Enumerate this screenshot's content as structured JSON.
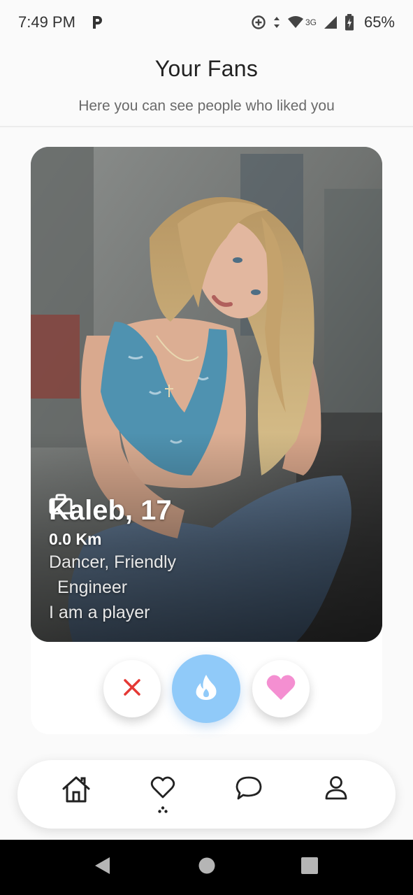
{
  "status_bar": {
    "time": "7:49 PM",
    "p_label": "P",
    "network": "3G",
    "battery": "65%"
  },
  "header": {
    "title": "Your Fans",
    "subtitle": "Here you can see people who liked you"
  },
  "profile": {
    "name_age": "Kaleb, 17",
    "distance": "0.0 Km",
    "tags": "Dancer, Friendly",
    "job": "Engineer",
    "bio": "I am a player"
  },
  "actions": {
    "dislike_icon": "close-icon",
    "superlike_icon": "flame-icon",
    "like_icon": "heart-icon"
  },
  "nav": {
    "items": [
      "home-icon",
      "heart-outline-icon",
      "chat-icon",
      "user-icon"
    ]
  },
  "colors": {
    "dislike": "#e53935",
    "superlike_bg": "#90caf9",
    "like": "#f48fd1",
    "nav_bar": "#000000"
  }
}
